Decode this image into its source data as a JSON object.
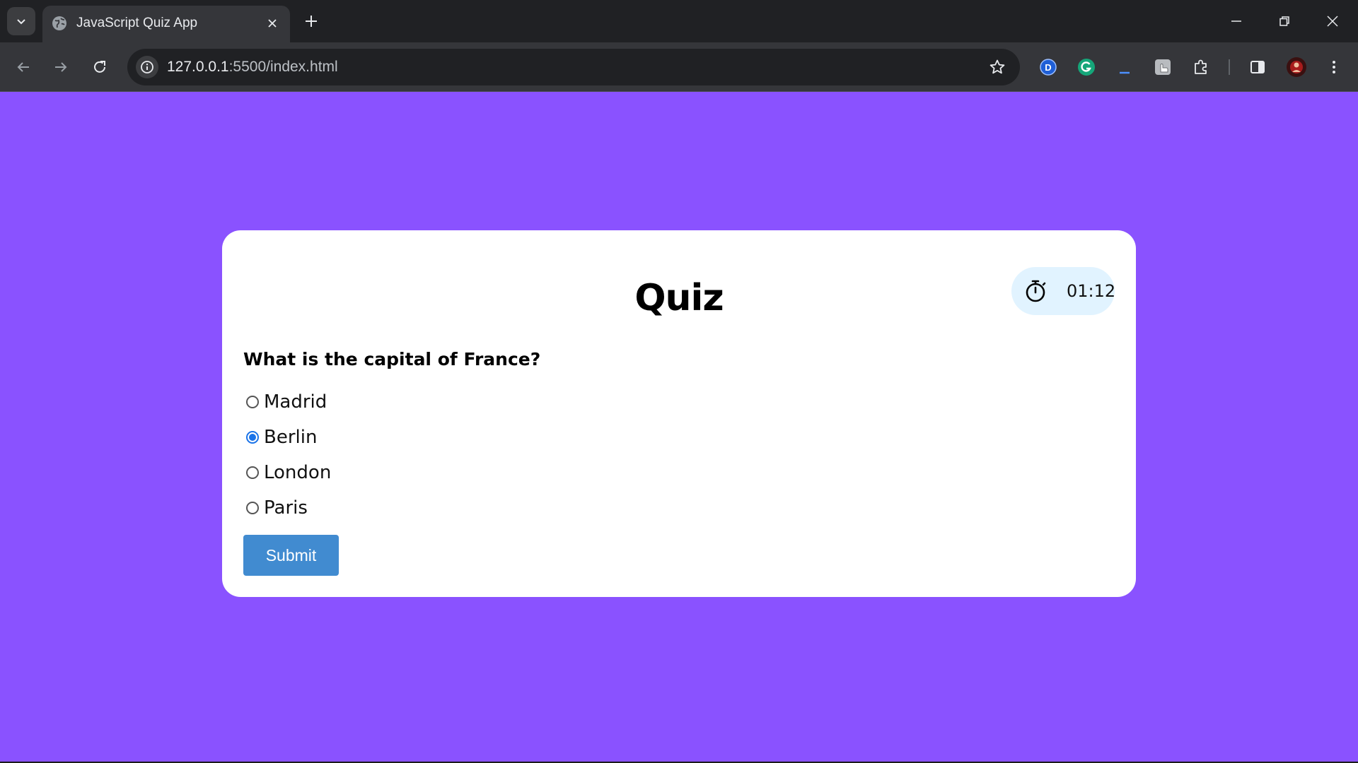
{
  "browser": {
    "tab": {
      "title": "JavaScript Quiz App"
    },
    "address": {
      "host": "127.0.0.1",
      "path": ":5500/index.html"
    },
    "extensions": [
      "dashlane-icon",
      "grammarly-icon",
      "download-progress-icon",
      "screen-capture-icon",
      "puzzle-icon"
    ],
    "colors": {
      "tabstrip": "#202124",
      "toolbar": "#35363a",
      "omnibox": "#202124"
    }
  },
  "page": {
    "background": "#8a52ff",
    "quiz": {
      "title": "Quiz",
      "timer": "01:12",
      "question": "What is the capital of France?",
      "options": [
        {
          "label": "Madrid",
          "checked": false
        },
        {
          "label": "Berlin",
          "checked": true
        },
        {
          "label": "London",
          "checked": false
        },
        {
          "label": "Paris",
          "checked": false
        }
      ],
      "submit_label": "Submit"
    },
    "colors": {
      "card": "#ffffff",
      "timer_bg": "#e1f3ff",
      "submit_bg": "#418bd0",
      "radio_checked": "#1a73e8"
    }
  }
}
